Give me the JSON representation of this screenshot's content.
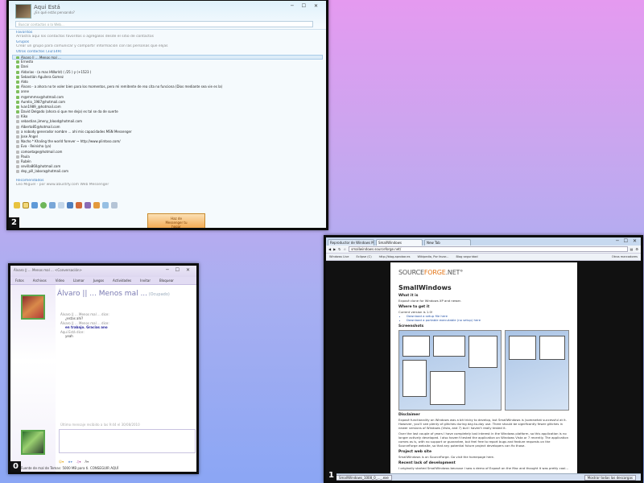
{
  "windows": {
    "w2": {
      "number": "2",
      "user": {
        "name": "Aqui Está",
        "status": "¿En qué estás pensando?"
      },
      "search_placeholder": "Buscar contactos o la Web...",
      "favoritos": {
        "title": "Favoritos",
        "hint": "Arrastra aquí los contactos favoritos o agrégalos desde el sitio de contactos"
      },
      "grupos": {
        "title": "Grupos",
        "hint": "Crear un grupo para comunicar y compartir información con las personas que elijas"
      },
      "otros_header": "Otros contactos (33/149)",
      "contacts": [
        "Álvaro || ... Menos mal ...",
        "Ernesto",
        "Dani",
        "Aldarias - (a mas HWorld) ( /25 ) y (+1523 )",
        "Sebastián Aguilera Gomez",
        "Aldo",
        "Álvaro - a ahora no te voler bien para los momentos, pero mi remitente de rea cita no funciona (Dios mediante sea vie es la)",
        "anne",
        "m@mmmsv@hotmail.com",
        "Aurelio_1987@hotmail.com",
        "Ivan1989_@hotmail.com",
        "David Delgado (ahora si que me deja) es tal se da de suerte",
        "Kiko",
        "sebastian.jimeny_blood@hotmail.com",
        "Alberto85@hotmail.com",
        "a nobody generador nombre ... ahí mis capacidades MSN Messenger",
        "Jose Ángel",
        "Nacho * Khaling the world forever ~ http://www.plintoso.com/",
        "Eva - Reinisha (ya)",
        "comoetage@hotmail.com",
        "Paula",
        "Rubén",
        "sevilla860@hotmail.com",
        "dep_pill_labora@hotmail.com"
      ],
      "recomendados": {
        "title": "Recomendados",
        "hint": "Leo Miguel - por www.abustify.com Web Messenger"
      },
      "ad_text": [
        "Haz de",
        "Messenger tu",
        "hogar"
      ]
    },
    "w0": {
      "number": "0",
      "title": "Álvaro || ... Menos mal ... <Conversación>",
      "menu": [
        "Fotos",
        "Archivos",
        "Video",
        "Llamar",
        "Juegos",
        "Actividades",
        "Invitar",
        "Bloquear"
      ],
      "contact_name": "Álvaro || ... Menos mal ...",
      "contact_state": "(Ocupado)",
      "messages": [
        {
          "from": "Álvaro || ... Menos mal ... dice:",
          "text": "¿estas ahí?"
        },
        {
          "from": "Álvaro || ... Menos mal ... dice:",
          "text": "en trabajo. Gracias ano"
        },
        {
          "from": "Aqui Está dice:",
          "text": "yeah"
        }
      ],
      "last_msg_note": "Último mensaje recibido a las 9:44 el 30/08/2010",
      "status_text": "Fuente de mal de Temas: 5000 MB para ti. CONSEGUIR AQUÍ"
    },
    "w1": {
      "number": "1",
      "tabs": [
        "Reproductor de Windows Media",
        "SmallWindows",
        "New Tab"
      ],
      "url": "smallwindows.sourceforge.net/",
      "bookmarks": [
        "Windows Live",
        "Eclipse (C)",
        "http://blog.aprobar.es",
        "Wikipedia, Por favor...",
        "Blog seguridad"
      ],
      "other_bookmarks": "Otros marcadores",
      "logo_prefix": "SOURCE",
      "logo_mid": "FORGE",
      "logo_suffix": ".NET°",
      "page": {
        "title": "SmallWindows",
        "what_h": "What it is",
        "what_p": "Exposé clone for Windows XP and newer.",
        "where_h": "Where to get it",
        "where_p": "Current version is 1.0!",
        "downloads": [
          "Download a setup file here",
          "Download a portable executable (no setup) here"
        ],
        "screenshots_h": "Screenshots",
        "disclaimer_h": "Disclaimer",
        "disclaimer_p": "Exposé functionality on Windows was a bit tricky to develop, but SmallWindows is (somewhat successful at it. However, you'll see plenty of glitches during day-to-day use. There should be significantly fewer glitches in newer versions of Windows (Vista, and 7) but I haven't really tested it.",
        "disclaimer_p2": "Over the last couple of years I have completely lost interest in the Windows platform, so this application is no longer actively developed. I also haven't tested the application on Windows Vista or 7 recently. The application comes as is, with no support or guarantee, but feel free to report bugs and feature requests on the SourceForge website, so that any potential future project developers can fix those.",
        "project_h": "Project web site",
        "project_p": "SmallWindows is on SourceForge. Go visit the homepage here.",
        "recent_h": "Recent lack of development",
        "recent_p": "I originally started SmallWindows because I saw a demo of Exposé on the Mac and thought it was pretty cool..."
      },
      "taskbar": [
        "SmallWindows_1008_0_..._.exe",
        "Mostrar todas las descargas"
      ]
    }
  }
}
